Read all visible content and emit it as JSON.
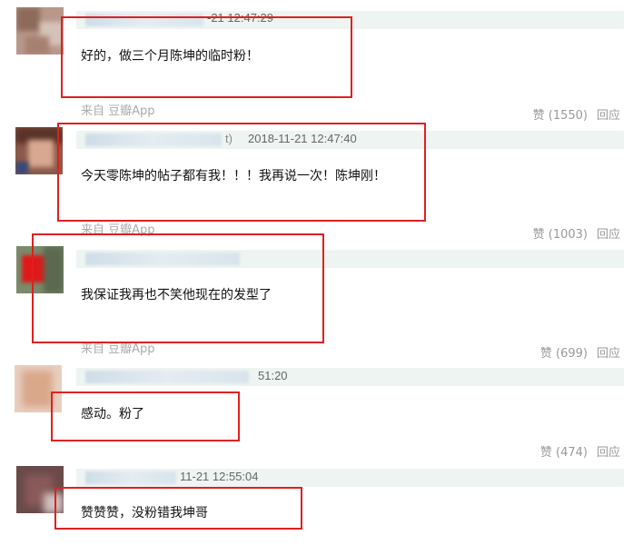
{
  "colors": {
    "highlight": "#e02020",
    "meta_bar": "#eef4f1",
    "action_text": "#999999"
  },
  "comments": [
    {
      "timestamp": "-21 12:47:29",
      "text": "好的，做三个月陈坤的临时粉！",
      "source": "来自 豆瓣App",
      "like": "赞 (1550)",
      "reply": "回应"
    },
    {
      "timestamp": "2018-11-21 12:47:40",
      "ts_prefix": "t)",
      "text": "今天零陈坤的帖子都有我！！！我再说一次！陈坤刚！",
      "source": "来自 豆瓣App",
      "like": "赞 (1003)",
      "reply": "回应"
    },
    {
      "timestamp": "",
      "text": "我保证我再也不笑他现在的发型了",
      "source": "来自 豆瓣App",
      "like": "赞 (699)",
      "reply": "回应"
    },
    {
      "timestamp": "51:20",
      "text": "感动。粉了",
      "source": "",
      "like": "赞 (474)",
      "reply": "回应"
    },
    {
      "timestamp": "11-21 12:55:04",
      "text": "赞赞赞，没粉错我坤哥",
      "source": "",
      "like": "",
      "reply": ""
    }
  ]
}
